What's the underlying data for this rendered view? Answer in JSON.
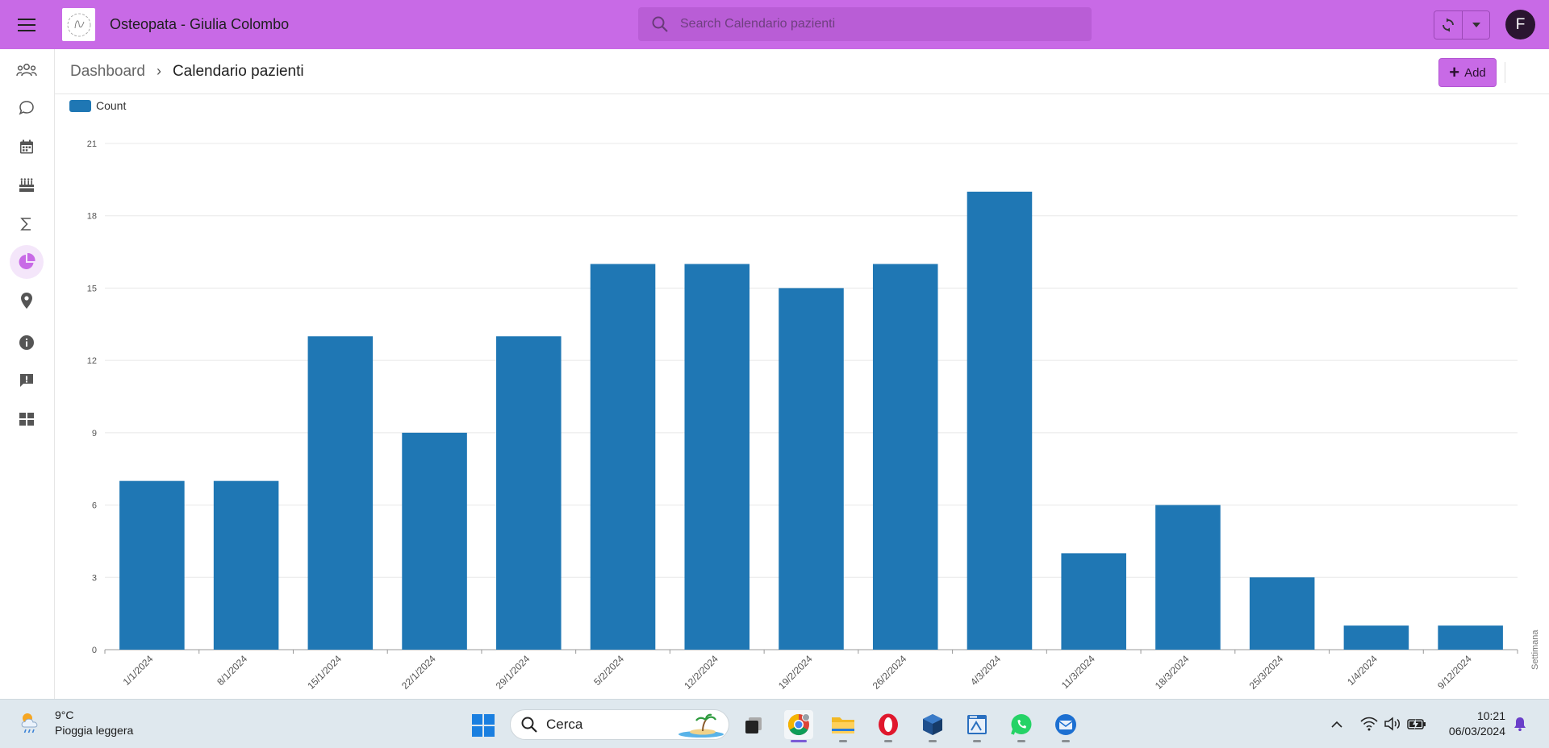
{
  "app": {
    "title": "Osteopata - Giulia Colombo",
    "avatar_initial": "F",
    "accent": "#c86ae6"
  },
  "search": {
    "placeholder": "Search Calendario pazienti"
  },
  "sidebar": {
    "items": [
      {
        "name": "patients",
        "icon": "people-icon",
        "active": false
      },
      {
        "name": "messages",
        "icon": "chat-bubble-icon",
        "active": false
      },
      {
        "name": "calendar",
        "icon": "calendar-icon",
        "active": false
      },
      {
        "name": "birthdays",
        "icon": "cake-icon",
        "active": false
      },
      {
        "name": "totals",
        "icon": "sigma-icon",
        "active": false
      },
      {
        "name": "charts",
        "icon": "pie-chart-icon",
        "active": true
      },
      {
        "name": "places",
        "icon": "map-pin-icon",
        "active": false
      },
      {
        "name": "info",
        "icon": "info-icon",
        "active": false
      },
      {
        "name": "feedback",
        "icon": "feedback-icon",
        "active": false
      },
      {
        "name": "dashboard",
        "icon": "dashboard-grid-icon",
        "active": false
      }
    ]
  },
  "header": {
    "breadcrumb_root": "Dashboard",
    "breadcrumb_sep": "›",
    "breadcrumb_current": "Calendario pazienti",
    "add_label": "Add"
  },
  "chart_data": {
    "type": "bar",
    "legend": [
      "Count"
    ],
    "legend_position": "top-left",
    "categories": [
      "1/1/2024",
      "8/1/2024",
      "15/1/2024",
      "22/1/2024",
      "29/1/2024",
      "5/2/2024",
      "12/2/2024",
      "19/2/2024",
      "26/2/2024",
      "4/3/2024",
      "11/3/2024",
      "18/3/2024",
      "25/3/2024",
      "1/4/2024",
      "9/12/2024"
    ],
    "series": [
      {
        "name": "Count",
        "values": [
          7,
          7,
          13,
          9,
          13,
          16,
          16,
          15,
          16,
          19,
          4,
          6,
          3,
          1,
          1
        ],
        "color": "#1f77b4"
      }
    ],
    "xlabel": "Settimana",
    "ylabel": "",
    "ylim": [
      0,
      21
    ],
    "yticks": [
      0,
      3,
      6,
      9,
      12,
      15,
      18,
      21
    ],
    "grid": true
  },
  "taskbar": {
    "weather_temp": "9°C",
    "weather_desc": "Pioggia leggera",
    "search_label": "Cerca",
    "time": "10:21",
    "date": "06/03/2024",
    "apps": [
      {
        "name": "task-view",
        "icon": "task-view-icon"
      },
      {
        "name": "chrome",
        "icon": "chrome-icon",
        "active": true
      },
      {
        "name": "file-explorer",
        "icon": "folder-icon"
      },
      {
        "name": "opera",
        "icon": "opera-icon"
      },
      {
        "name": "virtualbox",
        "icon": "virtualbox-icon"
      },
      {
        "name": "win-app",
        "icon": "app-window-icon"
      },
      {
        "name": "whatsapp",
        "icon": "whatsapp-icon"
      },
      {
        "name": "thunderbird",
        "icon": "thunderbird-icon"
      }
    ]
  }
}
